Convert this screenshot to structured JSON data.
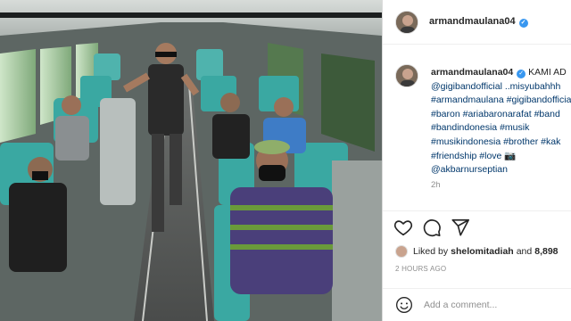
{
  "post": {
    "username": "armandmaulana04",
    "verified_icon": "verified-badge-icon",
    "photo_alt": "Band members posing inside a train carriage"
  },
  "caption": {
    "username": "armandmaulana04",
    "lines": [
      "KAMI AD",
      "@gigibandofficial ..misyubahhh",
      "#armandmaulana #gigibandofficial",
      "#baron #ariabaronarafat #band",
      "#bandindonesia #musik",
      "#musikindonesia #brother #kak",
      "#friendship #love 📷",
      "@akbarnurseptian"
    ],
    "time": "2h"
  },
  "actions": {
    "like_icon": "heart-icon",
    "comment_icon": "comment-icon",
    "share_icon": "share-icon"
  },
  "likes": {
    "prefix": "Liked by",
    "user": "shelomitadiah",
    "joiner": "and",
    "count": "8,898"
  },
  "post_date": "2 HOURS AGO",
  "comment": {
    "placeholder": "Add a comment...",
    "emoji_icon": "smiley-icon"
  },
  "colors": {
    "link": "#00376b",
    "verified": "#3897f0",
    "muted": "#8e8e8e",
    "seat_teal": "#3aa8a2"
  }
}
